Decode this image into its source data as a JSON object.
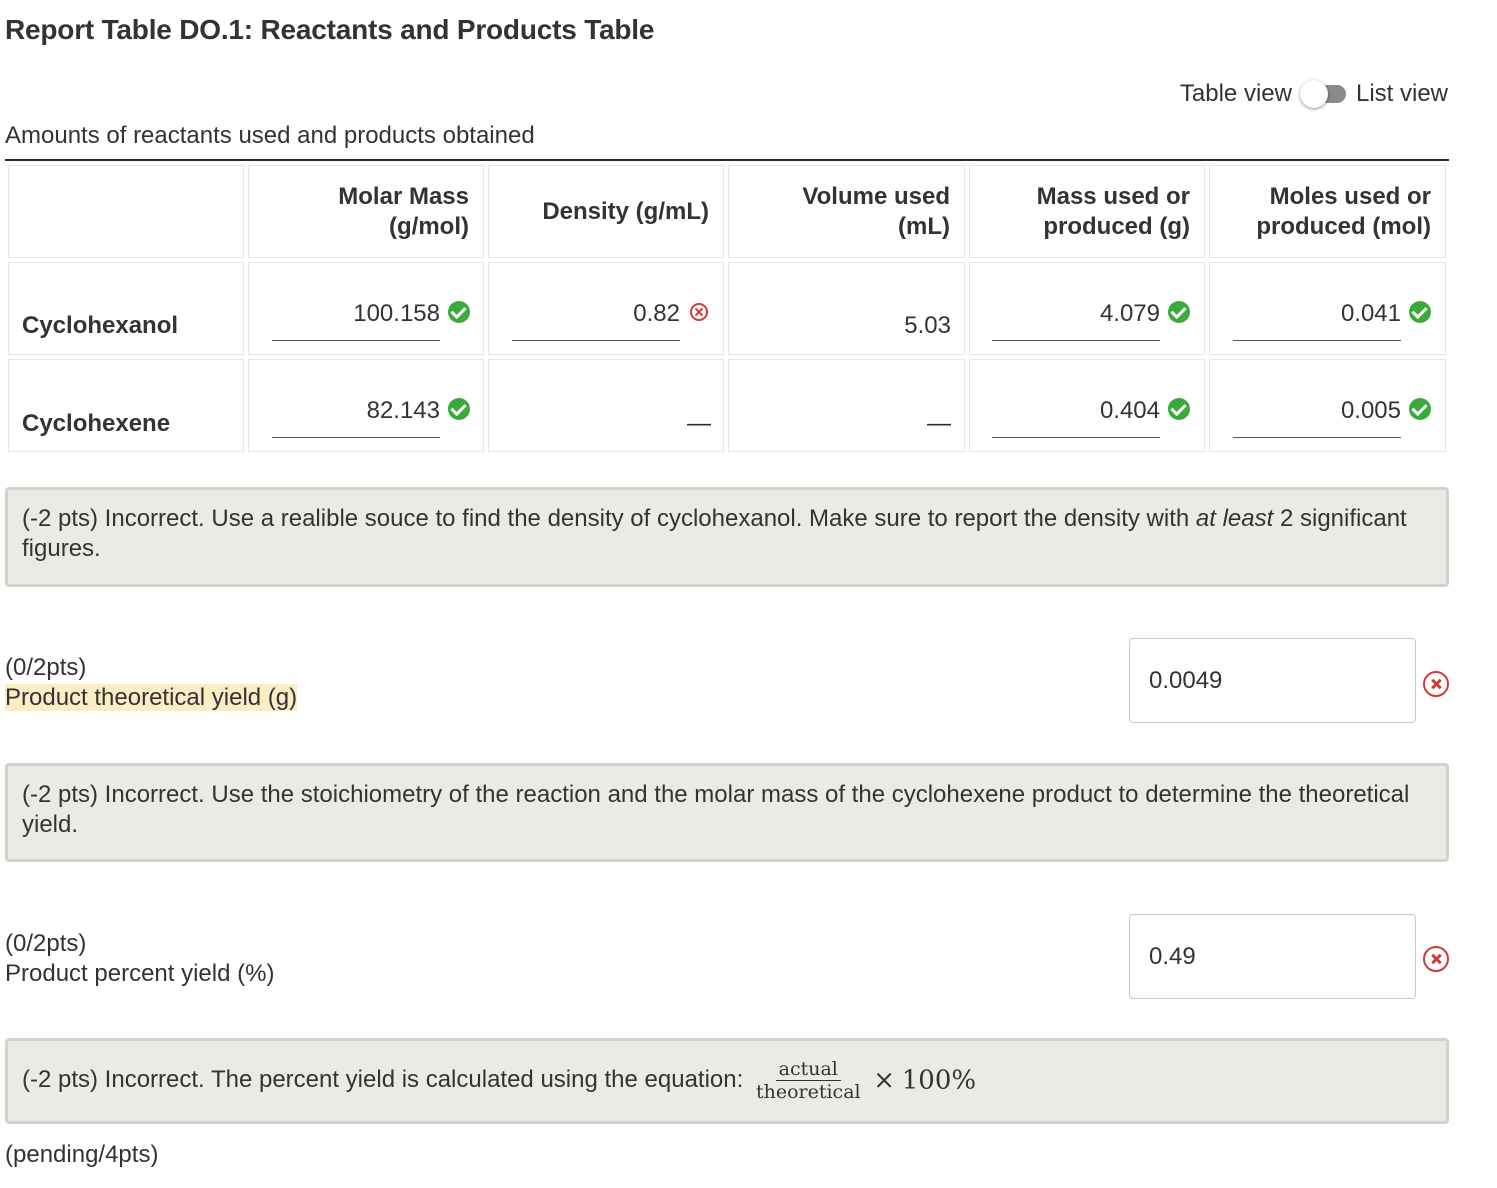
{
  "title": "Report Table DO.1: Reactants and Products Table",
  "view_toggle": {
    "left_label": "Table view",
    "right_label": "List view"
  },
  "table": {
    "caption": "Amounts of reactants used and products obtained",
    "headers": [
      "",
      "Molar Mass (g/mol)",
      "Density (g/mL)",
      "Volume used (mL)",
      "Mass used or produced (g)",
      "Moles used or produced (mol)"
    ],
    "header_lines": [
      [
        "",
        ""
      ],
      [
        "Molar Mass",
        "(g/mol)"
      ],
      [
        "Density (g/mL)",
        ""
      ],
      [
        "Volume used",
        "(mL)"
      ],
      [
        "Mass used or",
        "produced (g)"
      ],
      [
        "Moles used or",
        "produced (mol)"
      ]
    ],
    "rows": [
      {
        "label": "Cyclohexanol",
        "molar_mass": "100.158",
        "molar_mass_status": "correct",
        "density": "0.82",
        "density_status": "incorrect",
        "volume": "5.03",
        "mass": "4.079",
        "mass_status": "correct",
        "moles": "0.041",
        "moles_status": "correct"
      },
      {
        "label": "Cyclohexene",
        "molar_mass": "82.143",
        "molar_mass_status": "correct",
        "density": "—",
        "volume": "—",
        "mass": "0.404",
        "mass_status": "correct",
        "moles": "0.005",
        "moles_status": "correct"
      }
    ]
  },
  "feedback_1": {
    "before_em": "(-2 pts) Incorrect. Use a realible souce to find the density of cyclohexanol. Make sure to report the density with ",
    "em": "at least",
    "after_em": " 2 significant figures."
  },
  "q_theoretical": {
    "score": "(0/2pts)",
    "label": "Product theoretical yield (g)",
    "value": "0.0049",
    "status": "incorrect"
  },
  "feedback_2": "(-2 pts) Incorrect. Use the stoichiometry of the reaction and the molar mass of the cyclohexene product to determine the theoretical yield.",
  "q_percent": {
    "score": "(0/2pts)",
    "label": "Product percent yield (%)",
    "value": "0.49",
    "status": "incorrect"
  },
  "feedback_3": {
    "text": "(-2 pts) Incorrect. The percent yield is calculated using the equation:",
    "numerator": "actual",
    "denominator": "theoretical",
    "times": "×",
    "percent": "100%"
  },
  "pending": "(pending/4pts)",
  "colors": {
    "correct": "#3aab3a",
    "incorrect": "#cf3a3a",
    "feedback_bg": "#ebebe6",
    "highlight": "#fbeec4"
  }
}
